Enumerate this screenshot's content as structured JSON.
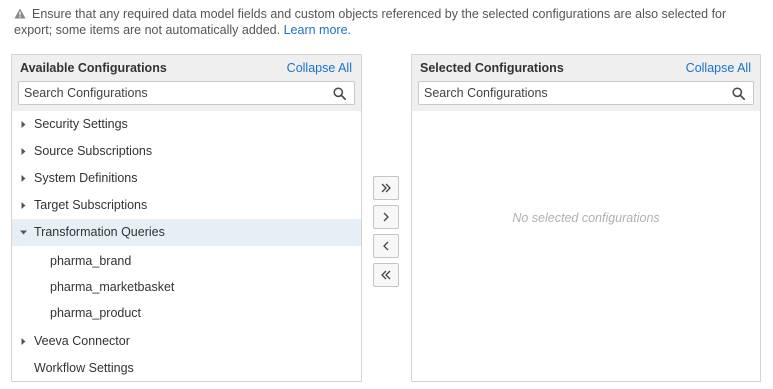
{
  "warning": {
    "text": "Ensure that any required data model fields and custom objects referenced by the selected configurations are also selected for export; some items are not automatically added.",
    "link": "Learn more."
  },
  "available": {
    "title": "Available Configurations",
    "collapse_label": "Collapse All",
    "search_placeholder": "Search Configurations",
    "items": [
      {
        "label": "Security Settings"
      },
      {
        "label": "Source Subscriptions"
      },
      {
        "label": "System Definitions"
      },
      {
        "label": "Target Subscriptions"
      },
      {
        "label": "Transformation Queries",
        "children": [
          "pharma_brand",
          "pharma_marketbasket",
          "pharma_product"
        ]
      },
      {
        "label": "Veeva Connector"
      },
      {
        "label": "Workflow Settings"
      }
    ]
  },
  "selected": {
    "title": "Selected Configurations",
    "collapse_label": "Collapse All",
    "search_placeholder": "Search Configurations",
    "empty_message": "No selected configurations"
  },
  "colors": {
    "link": "#1a73c8",
    "header_bg": "#efefef",
    "selected_row_bg": "#e6eef6"
  }
}
